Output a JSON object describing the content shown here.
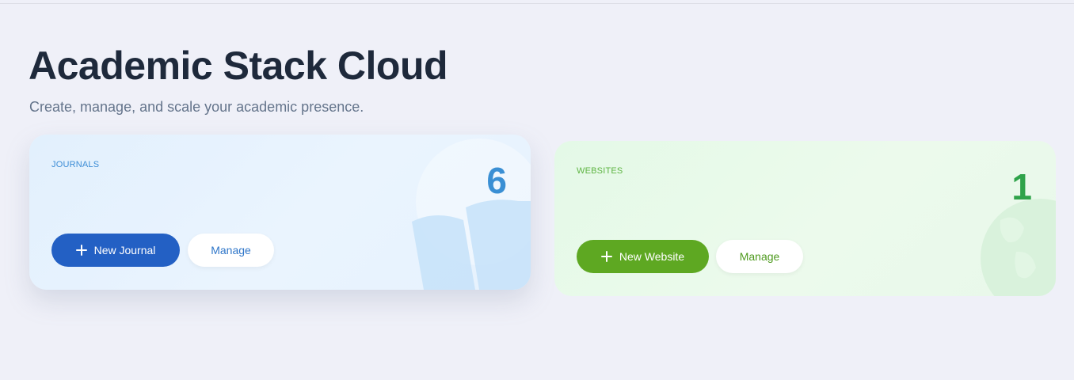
{
  "header": {
    "title": "Academic Stack Cloud",
    "subtitle": "Create, manage, and scale your academic presence."
  },
  "cards": [
    {
      "label": "JOURNALS",
      "count": "6",
      "primary_button": "New Journal",
      "secondary_button": "Manage",
      "icon": "book-icon",
      "accent": "#2360c4"
    },
    {
      "label": "WEBSITES",
      "count": "1",
      "primary_button": "New Website",
      "secondary_button": "Manage",
      "icon": "globe-icon",
      "accent": "#5ea822"
    }
  ]
}
